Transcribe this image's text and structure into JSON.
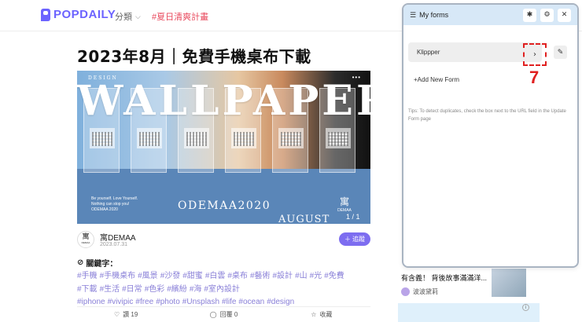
{
  "topnav": {
    "logo_text": "POPDAILY",
    "category_label": "分類",
    "hot_topic": "#夏日清爽計畫"
  },
  "article": {
    "title": "2023年8月｜免費手機桌布下載",
    "hero": {
      "top_label": "DESIGN",
      "dots": "•••",
      "big_text": "WALLPAPERS",
      "small_text": "Be yourself. Love Yourself. Nothing can stop you! ODEMAA 2020",
      "brand": "ODEMAA2020",
      "mark": "寓",
      "mark_sub": "DEMAA",
      "month": "AUGUST",
      "counter": "1 / 1"
    },
    "author": {
      "avatar_text": "寓",
      "avatar_sub": "DEMAA",
      "name": "寓DEMAA",
      "date": "2023.07.31",
      "follow_label": "追蹤"
    },
    "keywords_title": "關鍵字：",
    "tags_line1": [
      "#手機",
      "#手機桌布",
      "#風景",
      "#沙發",
      "#甜蜜",
      "#白雲",
      "#桌布",
      "#藝術",
      "#設計",
      "#山",
      "#光",
      "#免費"
    ],
    "tags_line2": [
      "#下載",
      "#生活",
      "#日常",
      "#色彩",
      "#繽紛",
      "#海",
      "#室內設計"
    ],
    "tags_line3": [
      "#iphone",
      "#vivipic",
      "#free",
      "#photo",
      "#Unsplash",
      "#life",
      "#ocean",
      "#design"
    ],
    "actions": {
      "like": "讚 19",
      "reply": "回覆 0",
      "save": "收藏"
    }
  },
  "sidebar": {
    "story_title": "有含義！ 背後故事滿滿洋...",
    "story_author": "波波黛莉"
  },
  "panel": {
    "title": "My forms",
    "form_name": "Klippper",
    "add_form_label": "+Add New Form",
    "tips": "Tips: To detect duplicates, check the box next to the URL field in the Update Form page",
    "step_number": "7",
    "accent_color": "#e02020"
  }
}
